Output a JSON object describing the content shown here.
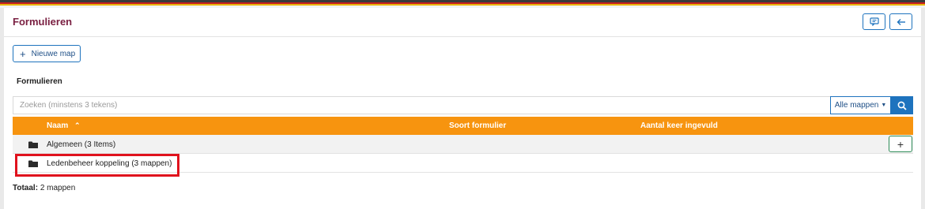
{
  "header": {
    "title": "Formulieren",
    "feedback_icon": "message-icon",
    "back_icon": "arrow-left-icon"
  },
  "toolbar": {
    "new_folder_label": "Nieuwe map"
  },
  "section": {
    "title": "Formulieren"
  },
  "search": {
    "placeholder": "Zoeken (minstens 3 tekens)",
    "filter_label": "Alle mappen",
    "search_icon": "search-icon"
  },
  "table": {
    "columns": [
      "Naam",
      "Soort formulier",
      "Aantal keer ingevuld"
    ],
    "sort_indicator": "⌃",
    "rows": [
      {
        "name": "Algemeen (3 Items)",
        "icon": "folder-icon"
      },
      {
        "name": "Ledenbeheer koppeling (3 mappen)",
        "icon": "folder-icon"
      }
    ],
    "add_label": "+"
  },
  "footer": {
    "total_label": "Totaal:",
    "total_value": "2 mappen"
  },
  "colors": {
    "accent": "#1e73be",
    "table_header": "#f7940f",
    "title": "#7a2042",
    "highlight": "#e0121d"
  }
}
